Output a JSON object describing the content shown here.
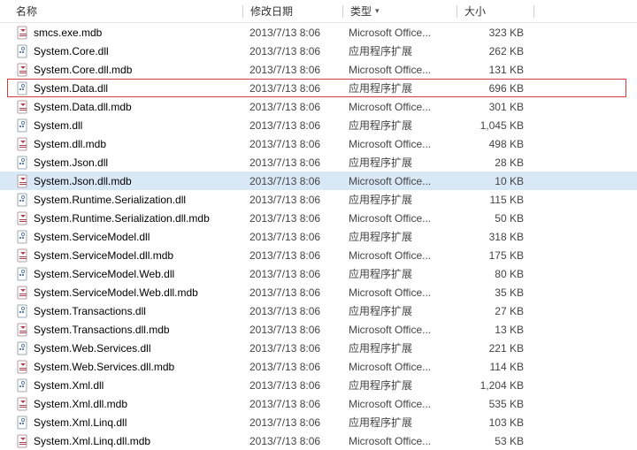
{
  "columns": {
    "name": "名称",
    "date": "修改日期",
    "type": "类型",
    "size": "大小"
  },
  "types": {
    "dll": "应用程序扩展",
    "mdb": "Microsoft Office..."
  },
  "icons": {
    "dll": "dll-file-icon",
    "mdb": "mdb-file-icon"
  },
  "files": [
    {
      "name": "smcs.exe.mdb",
      "date": "2013/7/13 8:06",
      "kind": "mdb",
      "size": "323 KB",
      "state": ""
    },
    {
      "name": "System.Core.dll",
      "date": "2013/7/13 8:06",
      "kind": "dll",
      "size": "262 KB",
      "state": ""
    },
    {
      "name": "System.Core.dll.mdb",
      "date": "2013/7/13 8:06",
      "kind": "mdb",
      "size": "131 KB",
      "state": ""
    },
    {
      "name": "System.Data.dll",
      "date": "2013/7/13 8:06",
      "kind": "dll",
      "size": "696 KB",
      "state": "highlighted"
    },
    {
      "name": "System.Data.dll.mdb",
      "date": "2013/7/13 8:06",
      "kind": "mdb",
      "size": "301 KB",
      "state": ""
    },
    {
      "name": "System.dll",
      "date": "2013/7/13 8:06",
      "kind": "dll",
      "size": "1,045 KB",
      "state": ""
    },
    {
      "name": "System.dll.mdb",
      "date": "2013/7/13 8:06",
      "kind": "mdb",
      "size": "498 KB",
      "state": ""
    },
    {
      "name": "System.Json.dll",
      "date": "2013/7/13 8:06",
      "kind": "dll",
      "size": "28 KB",
      "state": ""
    },
    {
      "name": "System.Json.dll.mdb",
      "date": "2013/7/13 8:06",
      "kind": "mdb",
      "size": "10 KB",
      "state": "selected"
    },
    {
      "name": "System.Runtime.Serialization.dll",
      "date": "2013/7/13 8:06",
      "kind": "dll",
      "size": "115 KB",
      "state": ""
    },
    {
      "name": "System.Runtime.Serialization.dll.mdb",
      "date": "2013/7/13 8:06",
      "kind": "mdb",
      "size": "50 KB",
      "state": ""
    },
    {
      "name": "System.ServiceModel.dll",
      "date": "2013/7/13 8:06",
      "kind": "dll",
      "size": "318 KB",
      "state": ""
    },
    {
      "name": "System.ServiceModel.dll.mdb",
      "date": "2013/7/13 8:06",
      "kind": "mdb",
      "size": "175 KB",
      "state": ""
    },
    {
      "name": "System.ServiceModel.Web.dll",
      "date": "2013/7/13 8:06",
      "kind": "dll",
      "size": "80 KB",
      "state": ""
    },
    {
      "name": "System.ServiceModel.Web.dll.mdb",
      "date": "2013/7/13 8:06",
      "kind": "mdb",
      "size": "35 KB",
      "state": ""
    },
    {
      "name": "System.Transactions.dll",
      "date": "2013/7/13 8:06",
      "kind": "dll",
      "size": "27 KB",
      "state": ""
    },
    {
      "name": "System.Transactions.dll.mdb",
      "date": "2013/7/13 8:06",
      "kind": "mdb",
      "size": "13 KB",
      "state": ""
    },
    {
      "name": "System.Web.Services.dll",
      "date": "2013/7/13 8:06",
      "kind": "dll",
      "size": "221 KB",
      "state": ""
    },
    {
      "name": "System.Web.Services.dll.mdb",
      "date": "2013/7/13 8:06",
      "kind": "mdb",
      "size": "114 KB",
      "state": ""
    },
    {
      "name": "System.Xml.dll",
      "date": "2013/7/13 8:06",
      "kind": "dll",
      "size": "1,204 KB",
      "state": ""
    },
    {
      "name": "System.Xml.dll.mdb",
      "date": "2013/7/13 8:06",
      "kind": "mdb",
      "size": "535 KB",
      "state": ""
    },
    {
      "name": "System.Xml.Linq.dll",
      "date": "2013/7/13 8:06",
      "kind": "dll",
      "size": "103 KB",
      "state": ""
    },
    {
      "name": "System.Xml.Linq.dll.mdb",
      "date": "2013/7/13 8:06",
      "kind": "mdb",
      "size": "53 KB",
      "state": ""
    }
  ]
}
